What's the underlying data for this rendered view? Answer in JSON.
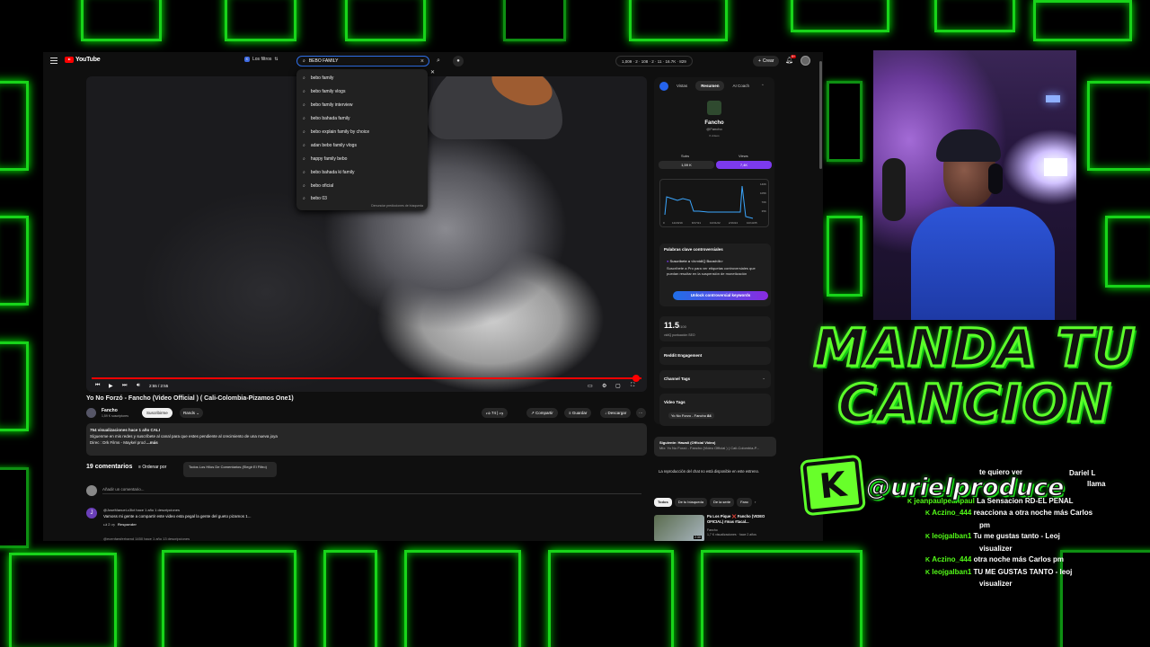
{
  "youtube": {
    "logo": "YouTube",
    "filters_label": "Los filtros",
    "search_value": "BEBO FAMILY",
    "stats_text": "1,009 · 2 · 108 · 2 · 11 · 16.7K · 829",
    "create_label": "Crear",
    "notif_count": "9+",
    "suggestions": [
      "bebo family",
      "bebo family vlogs",
      "bebo family interview",
      "bebo bahada family",
      "bebo explain family by choice",
      "adan bebo family vlogs",
      "happy family bebo",
      "bebo bahada ki family",
      "bebo oficial",
      "bebo 03"
    ],
    "suggest_footer": "Denunciar predicciones de búsqueda",
    "player": {
      "time": "2:55 / 2:55"
    },
    "video_title": "Yo No Forzó - Fancho (Video Official ) ( Cali-Colombia-Pizamos One1)",
    "channel": {
      "name": "Fancho",
      "subs": "1,59 K suscriptores",
      "subscribe_label": "Suscribirme",
      "rands_label": "Rands"
    },
    "actions": {
      "likes": "74",
      "share": "Compartir",
      "save": "Guardar",
      "download": "Descargar",
      "more": "···"
    },
    "description": {
      "meta": "754 visualizaciones  hace 1 año  CALI",
      "line1": "Síguenme en mis redes y suscríbete al canal para que estes pendiente al crecimiento de una nueva joya",
      "line2": "Direc : Drk Films - Maykel prod",
      "more": "...más"
    },
    "comments": {
      "count_label": "19 comentarios",
      "sort_label": "Ordenar por",
      "sort_option": "Todos Los Hilos De Comentarios (Elegir El Filtro)",
      "add_placeholder": "Añadir un comentario...",
      "first": {
        "user": "@JoseManuel-c3lct  hace 1 año  1 descripciones",
        "text": "Vamoss mi gente a compartir este video esta pegal la gente del gueto pizamos 1...",
        "reply": "Responder"
      },
      "second_user": "@ecenfarsferhamd 1450  hace 1 año  13 descripciones"
    },
    "panel": {
      "tabs": [
        "Vistas",
        "Resumen",
        "AI Coach"
      ],
      "channel_name": "Fancho",
      "channel_handle": "@Fancho",
      "channel_videos": "6 videos",
      "subs_label": "Subs",
      "subs_value": "1,59 K",
      "views_label": "Views",
      "views_value": "7,4K",
      "graph_y": [
        "140K",
        "105K",
        "70K",
        "35K",
        "0"
      ],
      "graph_x": [
        "0",
        "12/20/19",
        "8/17/21",
        "10/31/22",
        "2/16/24",
        "10/13/25"
      ],
      "controversial_title": "Palabras clave controversiales",
      "controversial_sub": "Suscríbete a <b>vidIQ Boost</b>",
      "controversial_text": "Suscríbete a Pro para ver etiquetas controversiales que puedan resultar en la suspensión de monetización",
      "unlock_label": "Unlock controversial keywords",
      "score_value": "11.5",
      "score_suffix": "/100",
      "score_label": "vidIQ puntuación SEO",
      "reddit_label": "Reddit Engagement",
      "channel_tags": "Channel Tags",
      "video_tags": "Video Tags",
      "tag_text": "Yo No Forzo - Fancho",
      "tag_count": "84"
    },
    "up_next": {
      "title": "Siguiente: Hawaii (Official Video)",
      "sub": "Mix: Yo No Forzó - Fancho (Video Official ) ( Cali-Colombia-P..."
    },
    "chat_note": "La reproducción del chat no está disponible en este estreno.",
    "chips": [
      "Todos",
      "De tu búsqueda",
      "De la serie",
      "Fanc"
    ],
    "related": {
      "title": "Pa Los Pique ❌ Fancho (VIDEO OFICIAL) #mas #tacal...",
      "channel": "Fancho",
      "meta": "1,7 K visualizaciones · hace 2 años",
      "duration": "2:30"
    }
  },
  "overlay": {
    "line1": "MANDA TU",
    "line2": "CANCION",
    "badge": "K",
    "handle": "@urielproduce"
  },
  "chat": [
    {
      "user": "",
      "msg": "te quiero ver"
    },
    {
      "user": "",
      "msg": "Dariel L"
    },
    {
      "user": "",
      "msg": "llama"
    },
    {
      "user": "jeanpaulpeanpaul",
      "msg": "La Sensacion RD-EL PENAL"
    },
    {
      "user": "Aczino_444",
      "msg": "reacciona a otra noche más Carlos"
    },
    {
      "user": "",
      "msg": "pm"
    },
    {
      "user": "leojgalban1",
      "msg": "Tu me gustas tanto - Leoj"
    },
    {
      "user": "",
      "msg": "visualizer"
    },
    {
      "user": "Aczino_444",
      "msg": "otra noche más Carlos pm"
    },
    {
      "user": "leojgalban1",
      "msg": "TU ME GUSTAS TANTO - leoj"
    },
    {
      "user": "",
      "msg": "visualizer"
    }
  ],
  "colors": {
    "neon": "#18d41a",
    "kick": "#53fc18",
    "yt_red": "#ff0000"
  }
}
